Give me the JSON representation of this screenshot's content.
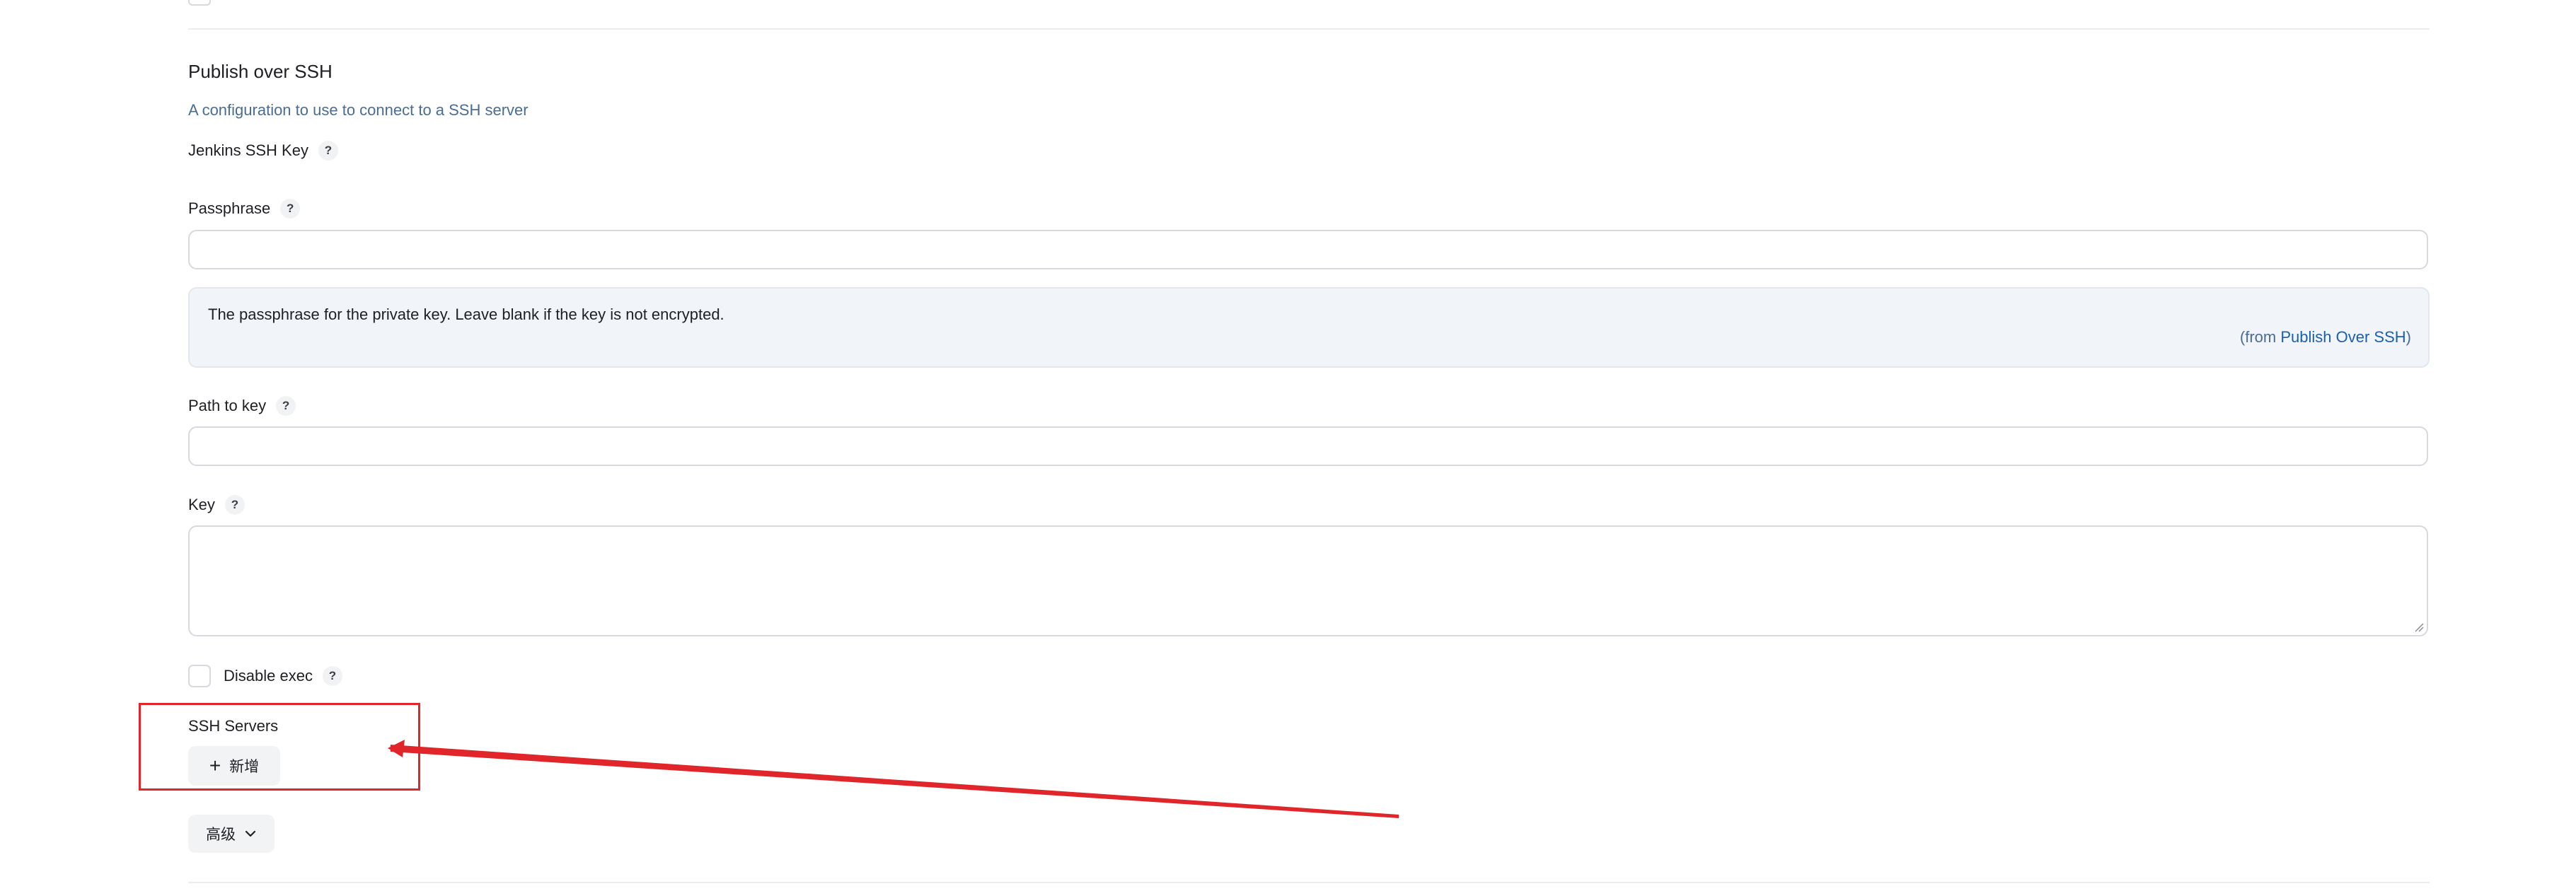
{
  "section": {
    "title": "Publish over SSH",
    "description": "A configuration to use to connect to a SSH server"
  },
  "fields": {
    "jenkins_ssh_key": {
      "label": "Jenkins SSH Key",
      "help": "?"
    },
    "passphrase": {
      "label": "Passphrase",
      "help": "?",
      "value": "",
      "help_text": "The passphrase for the private key. Leave blank if the key is not encrypted.",
      "help_from_prefix": "(from ",
      "help_from_link": "Publish Over SSH",
      "help_from_suffix": ")"
    },
    "path_to_key": {
      "label": "Path to key",
      "help": "?",
      "value": ""
    },
    "key": {
      "label": "Key",
      "help": "?",
      "value": ""
    },
    "disable_exec": {
      "label": "Disable exec",
      "help": "?",
      "checked": false
    }
  },
  "ssh_servers": {
    "label": "SSH Servers",
    "add_button_icon": "+",
    "add_button_label": "新增"
  },
  "advanced": {
    "label": "高级",
    "icon": "chevron-down-icon"
  },
  "annotation": {
    "color": "#e0262a"
  }
}
